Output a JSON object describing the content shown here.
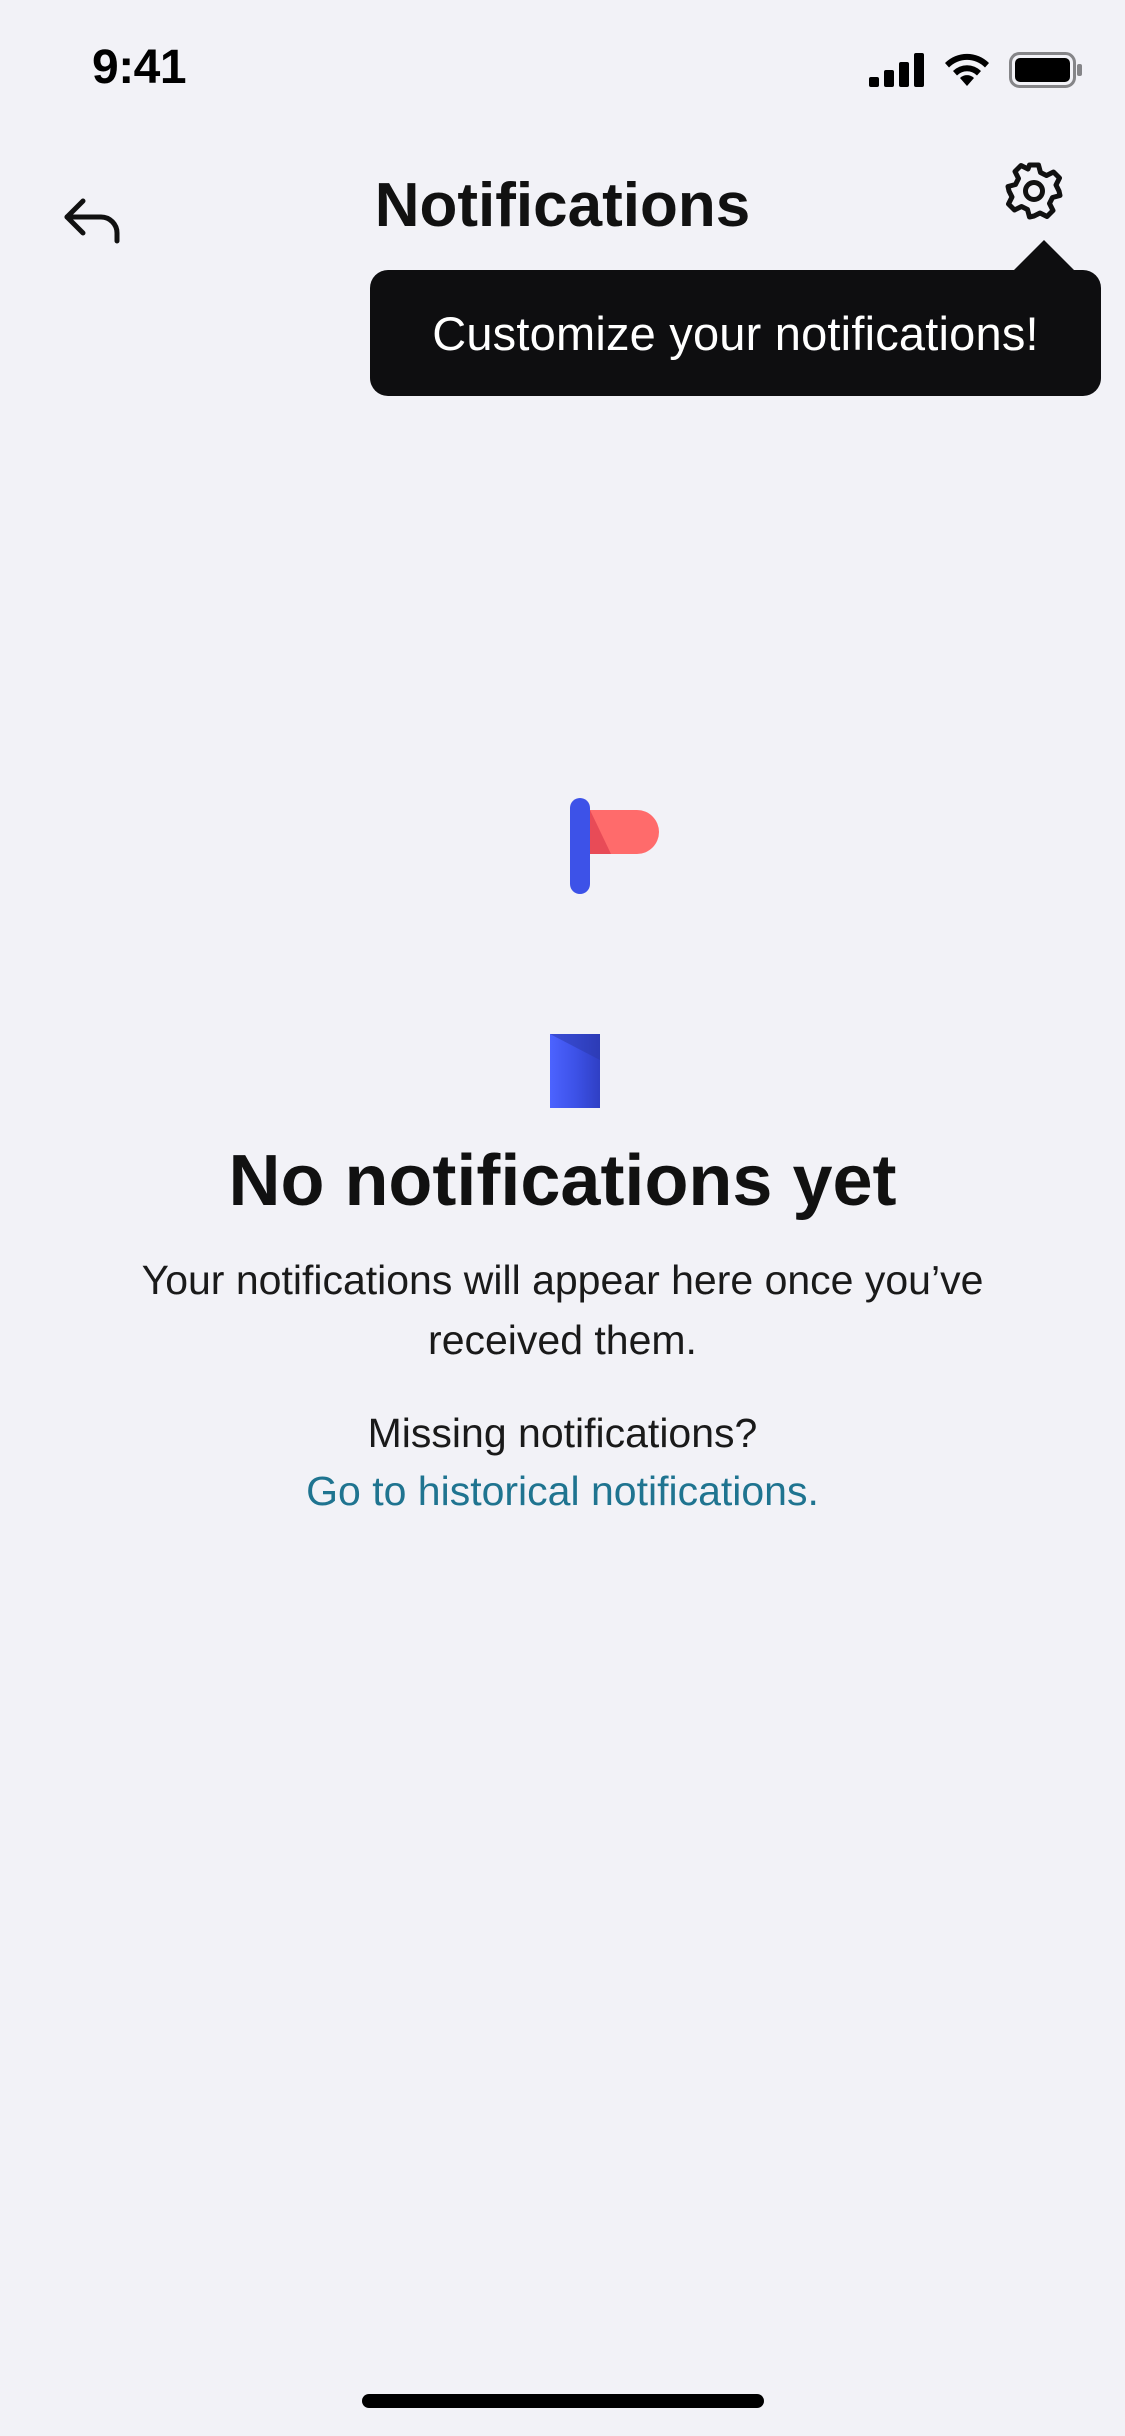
{
  "status_bar": {
    "time": "9:41",
    "icons": [
      "cellular-signal-icon",
      "wifi-icon",
      "battery-icon"
    ]
  },
  "nav": {
    "title": "Notifications",
    "back_icon": "back-arrow-icon",
    "settings_icon": "gear-icon"
  },
  "tooltip": {
    "text": "Customize your notifications!"
  },
  "empty_state": {
    "illustration": "mailbox-check-illustration",
    "title": "No notifications yet",
    "body": "Your notifications will appear here once you’ve received them.",
    "missing_label": "Missing notifications?",
    "link_text": "Go to historical notifications."
  },
  "colors": {
    "background": "#F2F2F7",
    "tooltip_background": "#0E0E10",
    "link": "#1F7490",
    "mailbox_blue": "#4C63FF",
    "flag_red": "#FF6B6B"
  }
}
